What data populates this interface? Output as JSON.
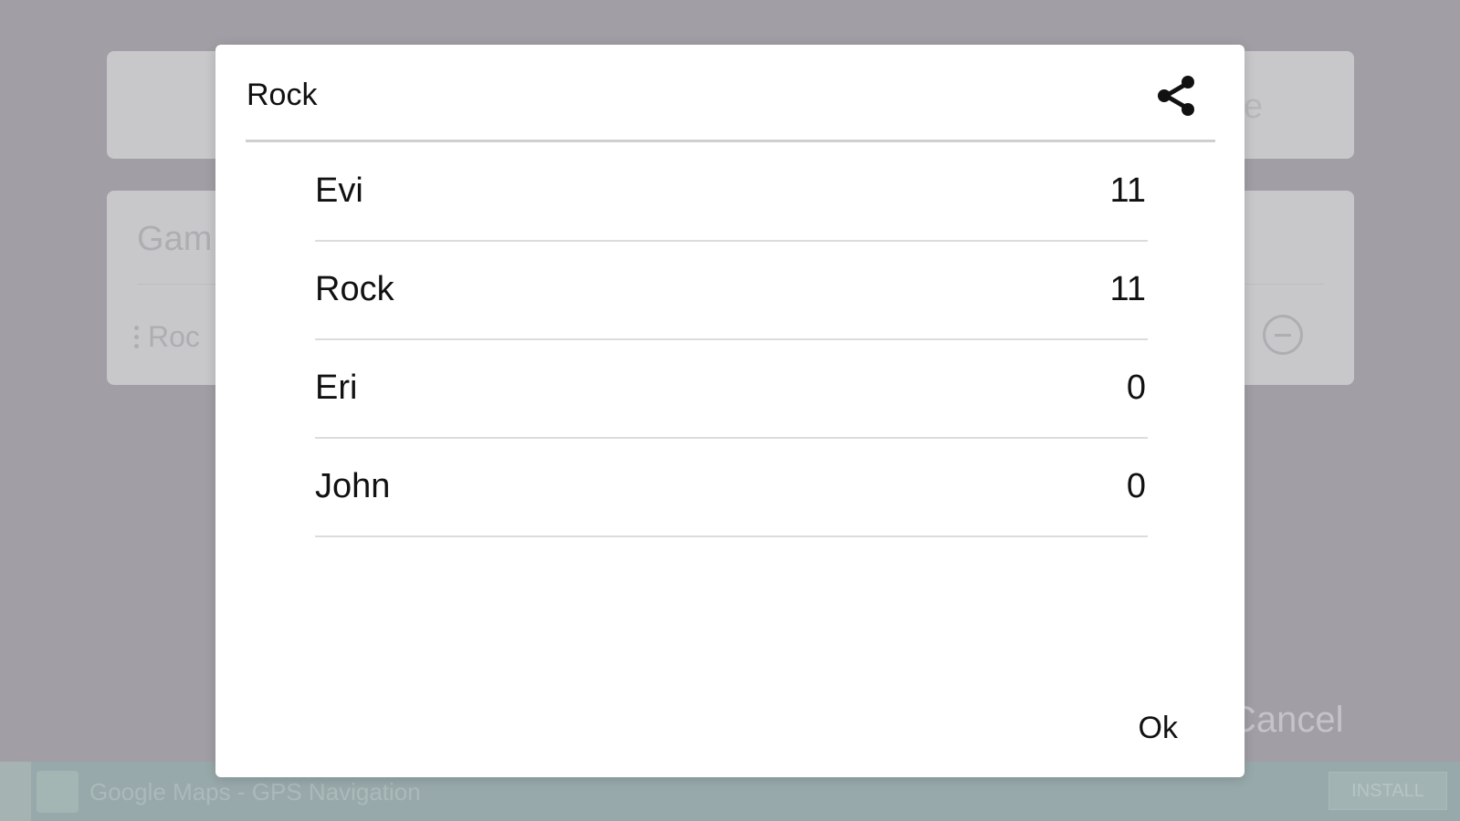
{
  "background": {
    "game_card_title": "Gam",
    "row_label": "Roc",
    "top_card_text": "e",
    "cancel_label": "Cancel"
  },
  "ad_banner": {
    "text": "Google Maps - GPS Navigation",
    "install_label": "INSTALL"
  },
  "dialog": {
    "title": "Rock",
    "share_icon": "share-icon",
    "rows": [
      {
        "name": "Evi",
        "score": "11"
      },
      {
        "name": "Rock",
        "score": "11"
      },
      {
        "name": "Eri",
        "score": "0"
      },
      {
        "name": "John",
        "score": "0"
      }
    ],
    "ok_label": "Ok"
  }
}
